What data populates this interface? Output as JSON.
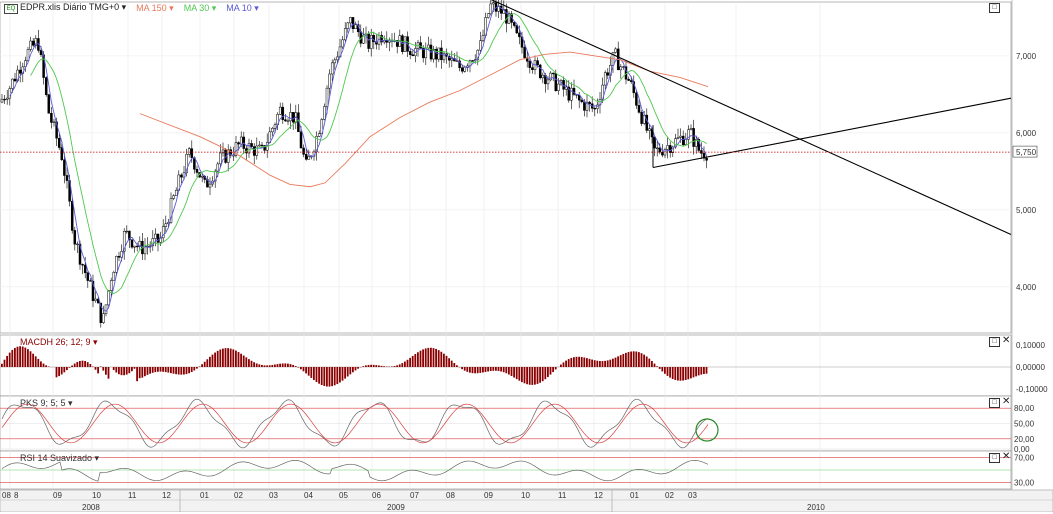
{
  "legend": {
    "symbol_text": "EQ",
    "instrument": "EDPR.xlis Diário TMG+0",
    "ma150": "MA 150",
    "ma30": "MA 30",
    "ma10": "MA 10"
  },
  "colors": {
    "candle_up": "#ffffff",
    "candle_down": "#000000",
    "ma150": "#e87a5a",
    "ma30": "#4fc84f",
    "ma10": "#5a5ad8",
    "macd": "#8b0000",
    "pks": "#d94040",
    "rsi": "#666666",
    "band": "#d94040",
    "price_line": "#c00000",
    "highlight_circle": "#2a8a2a"
  },
  "panels": {
    "macd_label": "MACDH 26; 12; 9",
    "pks_label": "PKS 9; 5; 5",
    "rsi_label": "RSI 14 Suavizado"
  },
  "chart_data": {
    "type": "candlestick",
    "instrument": "EDPR.xlis Diário TMG+0",
    "price_axis": {
      "ticks": [
        "7,000",
        "6,000",
        "5,000",
        "4,000"
      ],
      "range": [
        3.4,
        7.7
      ]
    },
    "last_price": "5,750",
    "x_ticks": [
      "08",
      "8",
      "09",
      "10",
      "11",
      "12",
      "01",
      "02",
      "03",
      "04",
      "05",
      "06",
      "07",
      "08",
      "09",
      "10",
      "11",
      "12",
      "01",
      "02",
      "03",
      "2010"
    ],
    "year_labels": [
      "2008",
      "2009",
      "2010"
    ],
    "macd_axis": {
      "ticks": [
        "0,10000",
        "0,00000",
        "-0,10000"
      ],
      "range": [
        -0.13,
        0.15
      ]
    },
    "pks_axis": {
      "ticks": [
        "80,00",
        "50,00",
        "20,00",
        "0,00"
      ],
      "range": [
        0,
        100
      ]
    },
    "rsi_axis": {
      "ticks": [
        "70,00",
        "30,00"
      ],
      "range": [
        20,
        80
      ]
    },
    "close_series": [
      6.4,
      6.6,
      7.0,
      7.2,
      6.6,
      5.9,
      5.0,
      4.2,
      3.6,
      4.2,
      4.6,
      4.7,
      4.9,
      5.6,
      5.7,
      5.5,
      5.6,
      5.7,
      5.8,
      5.9,
      6.2,
      6.3,
      5.8,
      5.7,
      6.8,
      7.3,
      7.2,
      7.1,
      7.3,
      7.2,
      6.9,
      7.1,
      7.6,
      7.2,
      6.9,
      6.7,
      6.5,
      6.4,
      6.1,
      6.6,
      7.0,
      6.5,
      6.2,
      5.8,
      5.95,
      6.0,
      5.75
    ],
    "annotations": {
      "down_trendline": {
        "from": [
          "2009-08",
          7.8
        ],
        "to": [
          "2010-03",
          4.7
        ]
      },
      "up_trendline": {
        "from": [
          "2010-01",
          5.55
        ],
        "to": [
          "2010-06",
          6.45
        ]
      }
    }
  }
}
